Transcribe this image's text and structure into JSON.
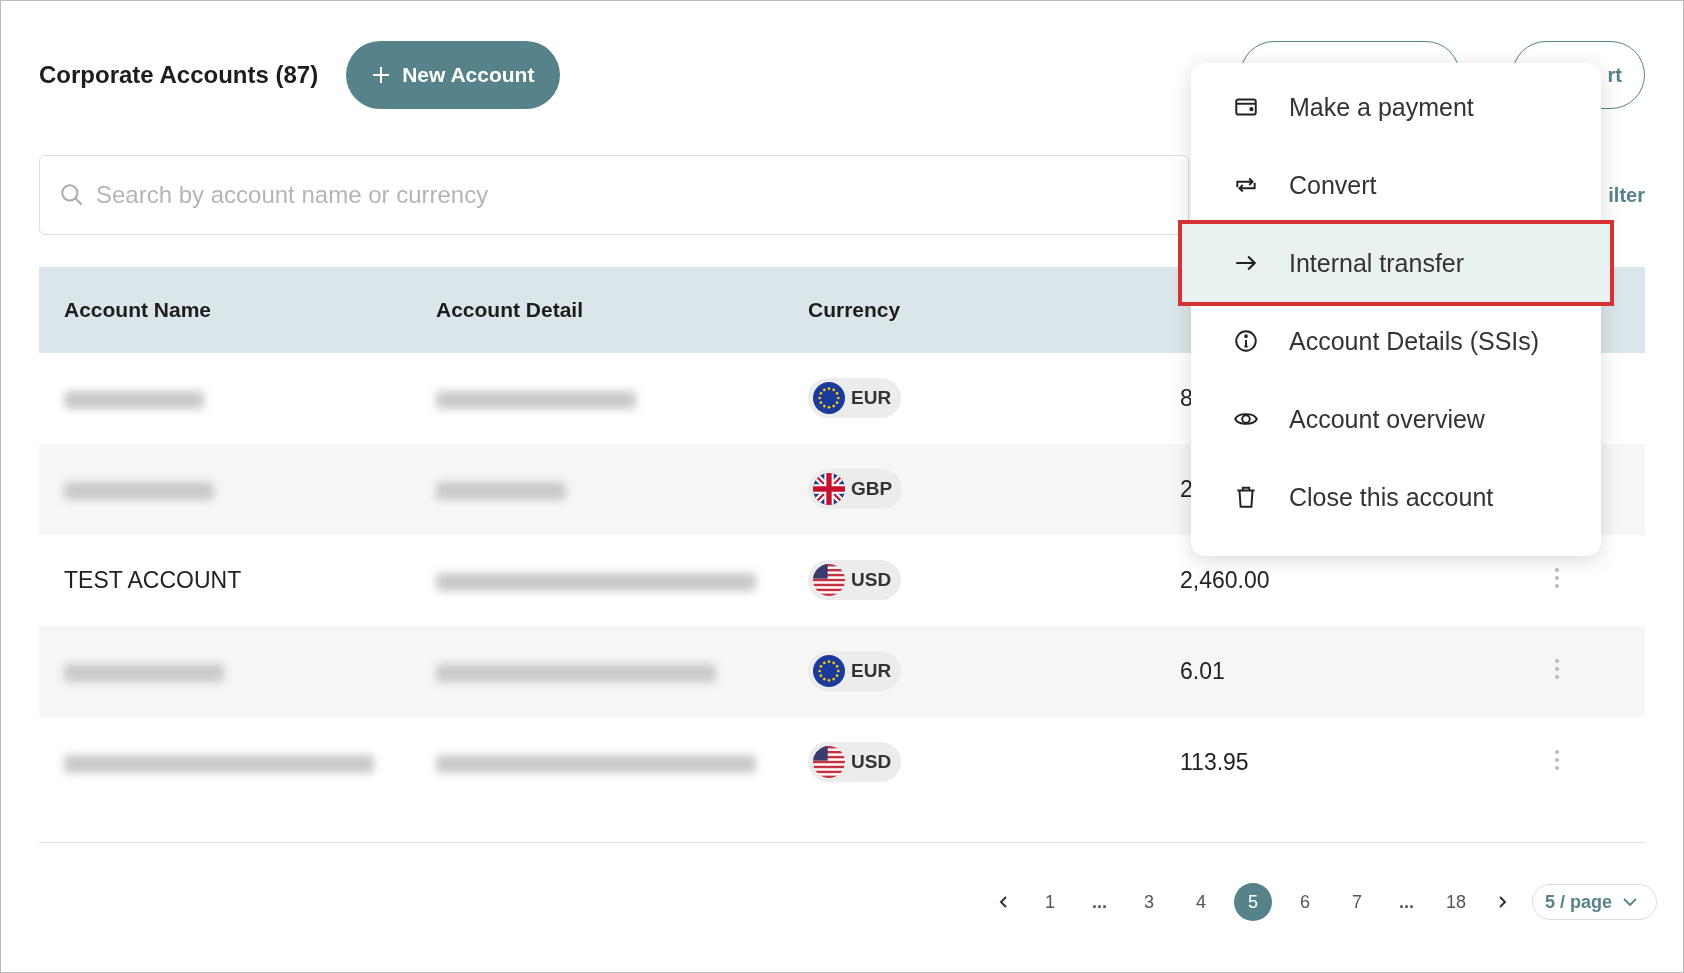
{
  "header": {
    "title": "Corporate Accounts (87)",
    "new_button": "New Account",
    "right_button": "rt"
  },
  "search": {
    "placeholder": "Search by account name or currency",
    "filter_label": "ilter"
  },
  "table": {
    "columns": [
      "Account Name",
      "Account Detail",
      "Currency"
    ],
    "rows": [
      {
        "name": null,
        "currency": "EUR",
        "kind": "eu",
        "balance": "8"
      },
      {
        "name": null,
        "currency": "GBP",
        "kind": "gb",
        "balance": "2"
      },
      {
        "name": "TEST ACCOUNT",
        "currency": "USD",
        "kind": "us",
        "balance": "2,460.00"
      },
      {
        "name": null,
        "currency": "EUR",
        "kind": "eu",
        "balance": "6.01"
      },
      {
        "name": null,
        "currency": "USD",
        "kind": "us",
        "balance": "113.95"
      }
    ]
  },
  "menu": {
    "items": [
      {
        "kind": "wallet",
        "label": "Make a payment",
        "selected": false
      },
      {
        "kind": "convert",
        "label": "Convert",
        "selected": false
      },
      {
        "kind": "arrow",
        "label": "Internal transfer",
        "selected": true
      },
      {
        "kind": "info",
        "label": "Account Details (SSIs)",
        "selected": false
      },
      {
        "kind": "eye",
        "label": "Account overview",
        "selected": false
      },
      {
        "kind": "trash",
        "label": "Close this account",
        "selected": false
      }
    ]
  },
  "pagination": {
    "items": [
      {
        "kind": "prev"
      },
      {
        "kind": "page",
        "label": "1",
        "selected": false
      },
      {
        "kind": "ellipsis",
        "label": "..."
      },
      {
        "kind": "page",
        "label": "3",
        "selected": false
      },
      {
        "kind": "page",
        "label": "4",
        "selected": false
      },
      {
        "kind": "page",
        "label": "5",
        "selected": true
      },
      {
        "kind": "page",
        "label": "6",
        "selected": false
      },
      {
        "kind": "page",
        "label": "7",
        "selected": false
      },
      {
        "kind": "ellipsis",
        "label": "..."
      },
      {
        "kind": "page",
        "label": "18",
        "selected": false
      },
      {
        "kind": "next"
      }
    ],
    "page_size": "5 / page"
  }
}
